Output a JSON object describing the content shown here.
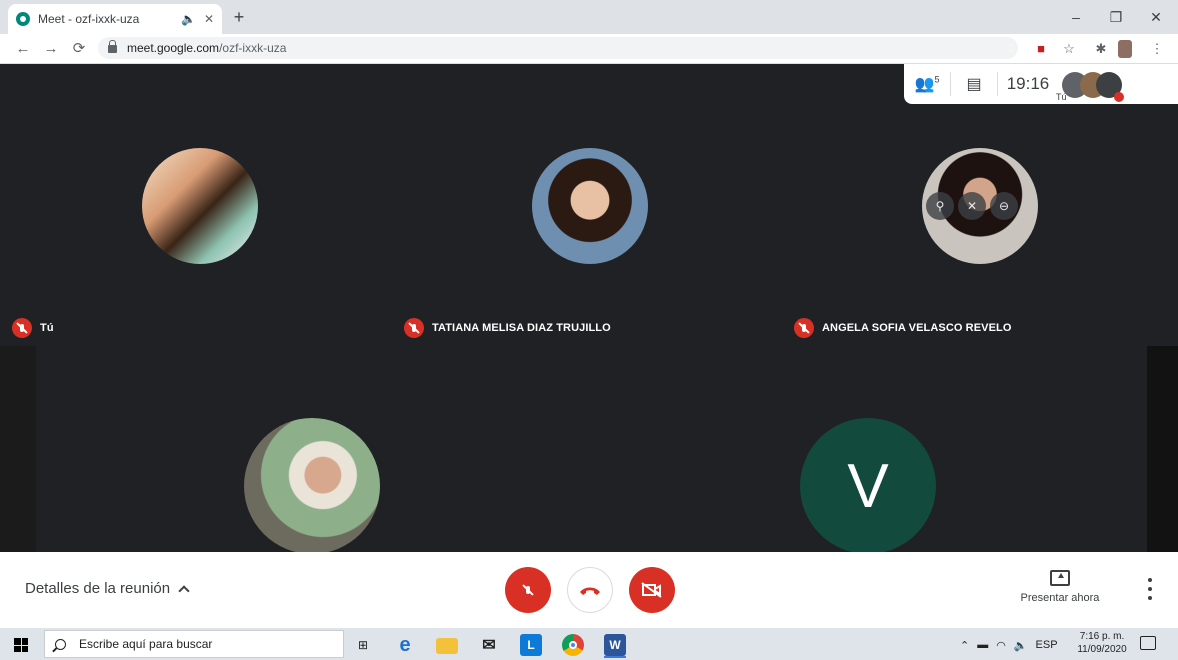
{
  "browser": {
    "tab_title": "Meet - ozf-ixxk-uza",
    "tab_audio_icon": "🔈",
    "tab_close": "✕",
    "new_tab": "+",
    "url_host": "meet.google.com",
    "url_path": "/ozf-ixxk-uza",
    "minimize": "–",
    "restore": "❐",
    "close": "✕"
  },
  "meet": {
    "participants_count": "5",
    "clock": "19:16",
    "self_label_small": "Tú",
    "participants": [
      {
        "name": "Tú"
      },
      {
        "name": "TATIANA MELISA DIAZ TRUJILLO"
      },
      {
        "name": "ANGELA SOFIA VELASCO REVELO"
      },
      {
        "name": ""
      },
      {
        "name": "",
        "initial": "V"
      }
    ],
    "avatar_colors": {
      "v_tile": "#124a3e"
    },
    "bottom": {
      "details_label": "Detalles de la reunión",
      "present_label": "Presentar ahora"
    }
  },
  "taskbar": {
    "search_placeholder": "Escribe aquí para buscar",
    "language": "ESP",
    "time": "7:16 p. m.",
    "date": "11/09/2020",
    "word_label": "W",
    "lync_label": "L"
  }
}
